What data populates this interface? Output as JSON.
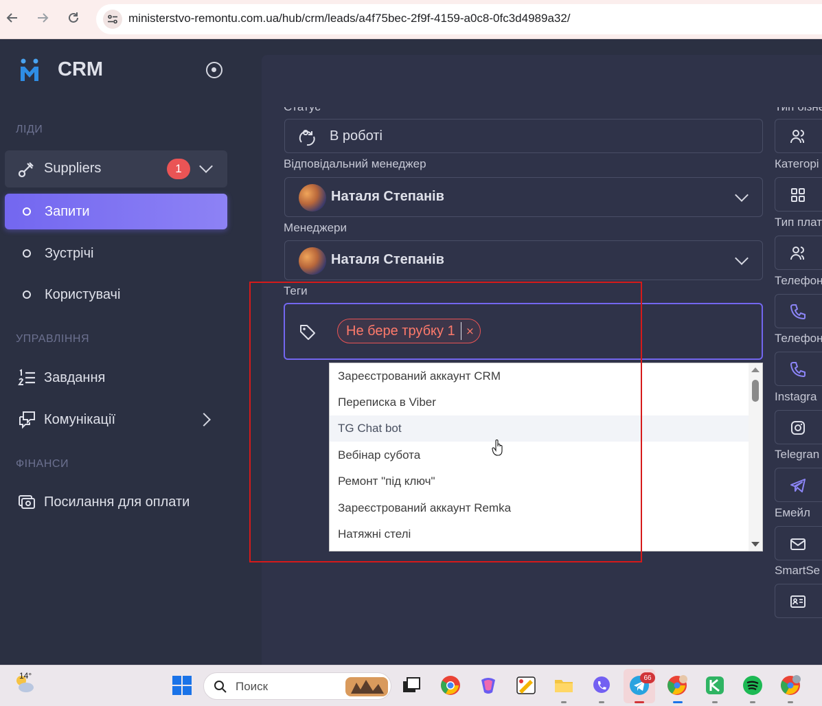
{
  "browser": {
    "url": "ministerstvo-remontu.com.ua/hub/crm/leads/a4f75bec-2f9f-4159-a0c8-0fc3d4989a32/"
  },
  "sidebar": {
    "app_title": "CRM",
    "sections": {
      "leads": "ЛІДИ",
      "management": "УПРАВЛІННЯ",
      "finance": "ФІНАНСИ"
    },
    "suppliers": {
      "label": "Suppliers",
      "badge": "1"
    },
    "sub_items": [
      {
        "label": "Запити",
        "active": true
      },
      {
        "label": "Зустрічі",
        "active": false
      },
      {
        "label": "Користувачі",
        "active": false
      }
    ],
    "tasks": {
      "label": "Завдання"
    },
    "communications": {
      "label": "Комунікації"
    },
    "payment_links": {
      "label": "Посилання для оплати"
    }
  },
  "form": {
    "status": {
      "label": "Статус",
      "value": "В роботі"
    },
    "responsible_manager": {
      "label": "Відповідальний менеджер",
      "value": "Наталя Степанів"
    },
    "managers": {
      "label": "Менеджери",
      "value": "Наталя Степанів"
    },
    "tags": {
      "label": "Теги",
      "selected": [
        {
          "label": "Не бере трубку 1",
          "remove": "×"
        }
      ],
      "options": [
        "Зареєстрований аккаунт CRM",
        "Переписка в Viber",
        "TG Chat bot",
        "Вебінар субота",
        "Ремонт \"під ключ\"",
        "Зареєстрований аккаунт Remka",
        "Натяжні стелі"
      ],
      "hovered_option": "TG Chat bot"
    }
  },
  "right_column": {
    "labels": [
      "Тип бізне",
      "Категорі",
      "Тип плат",
      "Телефон",
      "Телефон",
      "Instagra",
      "Telegran",
      "Емейл",
      "SmartSe"
    ],
    "icons": [
      "users-icon",
      "grid-icon",
      "users-icon",
      "phone-icon",
      "phone-icon",
      "instagram-icon",
      "telegram-icon",
      "mail-icon",
      "id-card-icon"
    ]
  },
  "taskbar": {
    "weather": "14°",
    "search_placeholder": "Поиск",
    "telegram_badge": "66"
  },
  "colors": {
    "accent": "#7367f0",
    "sidebar_bg": "#2b3042",
    "card_bg": "#2f3349",
    "badge_red": "#ea5455",
    "tag_text": "#ff7a6b"
  }
}
